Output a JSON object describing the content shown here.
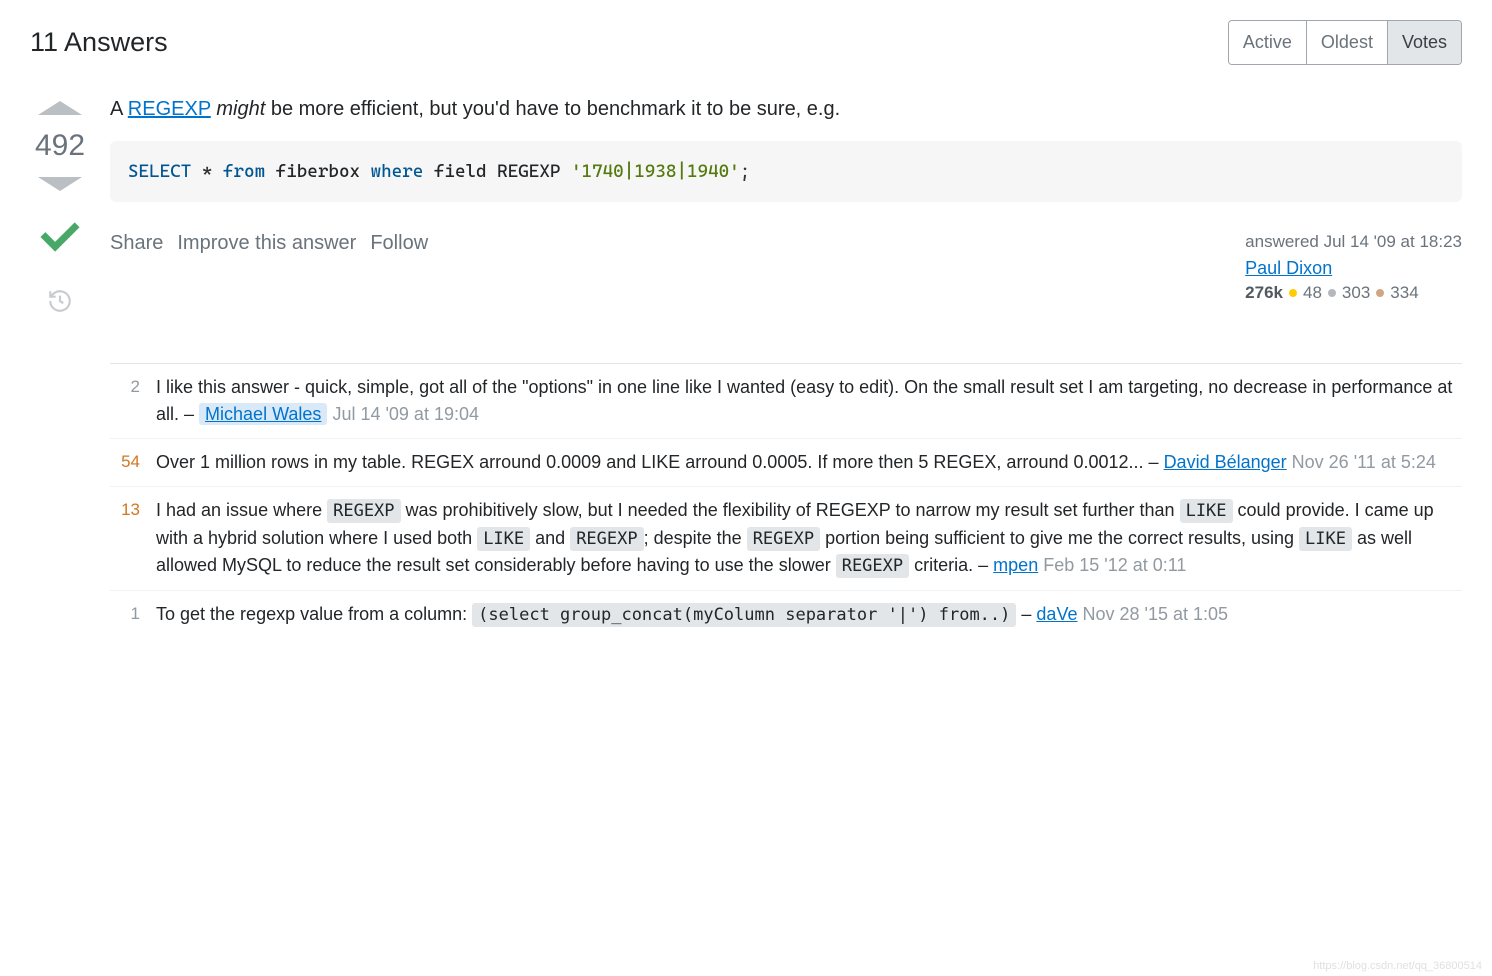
{
  "header": {
    "title": "11 Answers",
    "tabs": {
      "active": "Active",
      "oldest": "Oldest",
      "votes": "Votes"
    }
  },
  "answer": {
    "score": "492",
    "body_prefix": "A ",
    "body_link": "REGEXP",
    "body_might": "might",
    "body_suffix": " be more efficient, but you'd have to benchmark it to be sure, e.g.",
    "code": {
      "select": "SELECT",
      "star": " * ",
      "from": "from",
      "table": " fiberbox ",
      "where": "where",
      "field": " field REGEXP ",
      "lit": "'1740|1938|1940'",
      "semi": ";"
    },
    "actions": {
      "share": "Share",
      "improve": "Improve this answer",
      "follow": "Follow"
    },
    "user": {
      "answered": "answered Jul 14 '09 at 18:23",
      "name": "Paul Dixon",
      "rep": "276k",
      "gold": "48",
      "silver": "303",
      "bronze": "334"
    }
  },
  "comments": [
    {
      "score": "2",
      "score_class": "score-gray",
      "text_before": "I like this answer - quick, simple, got all of the \"options\" in one line like I wanted (easy to edit). On the small result set I am targeting, no decrease in performance at all.",
      "user": "Michael Wales",
      "op": true,
      "date": "Jul 14 '09 at 19:04"
    },
    {
      "score": "54",
      "score_class": "score-warm",
      "text_before": "Over 1 million rows in my table. REGEX arround 0.0009 and LIKE arround 0.0005. If more then 5 REGEX, arround 0.0012...",
      "user": "David Bélanger",
      "op": false,
      "date": "Nov 26 '11 at 5:24"
    },
    {
      "score": "13",
      "score_class": "score-warm",
      "html": true,
      "user": "mpen",
      "op": false,
      "date": "Feb 15 '12 at 0:11"
    },
    {
      "score": "1",
      "score_class": "score-gray",
      "html2": true,
      "user": "daVe",
      "op": false,
      "date": "Nov 28 '15 at 1:05"
    }
  ],
  "c3": {
    "p1": "I had an issue where ",
    "code1": "REGEXP",
    "p2": " was prohibitively slow, but I needed the flexibility of REGEXP to narrow my result set further than ",
    "code2": "LIKE",
    "p3": " could provide. I came up with a hybrid solution where I used both ",
    "code3": "LIKE",
    "p4": " and ",
    "code4": "REGEXP",
    "p5": "; despite the ",
    "code5": "REGEXP",
    "p6": " portion being sufficient to give me the correct results, using ",
    "code6": "LIKE",
    "p7": " as well allowed MySQL to reduce the result set considerably before having to use the slower ",
    "code7": "REGEXP",
    "p8": " criteria."
  },
  "c4": {
    "p1": "To get the regexp value from a column: ",
    "code1": "(select group_concat(myColumn separator '|') from..)"
  },
  "watermark": "https://blog.csdn.net/qq_36800514"
}
